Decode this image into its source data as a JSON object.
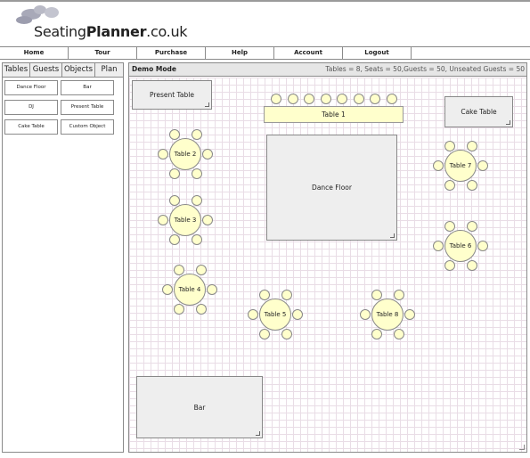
{
  "logo": {
    "prefix": "Seating",
    "bold": "Planner",
    "suffix": ".co.uk"
  },
  "nav": [
    "Home",
    "Tour",
    "Purchase",
    "Help",
    "Account",
    "Logout"
  ],
  "tabs": [
    "Tables",
    "Guests",
    "Objects",
    "Plan"
  ],
  "objects": [
    "Dance Floor",
    "Bar",
    "DJ",
    "Present Table",
    "Cake Table",
    "Custom Object"
  ],
  "header": {
    "mode": "Demo Mode",
    "stats": "Tables = 8, Seats = 50,Guests = 50, Unseated Guests = 50"
  },
  "plan": {
    "present_table": "Present Table",
    "cake_table": "Cake Table",
    "dance_floor": "Dance Floor",
    "bar": "Bar",
    "table1": "Table 1",
    "tables": [
      "Table 2",
      "Table 3",
      "Table 4",
      "Table 5",
      "Table 6",
      "Table 7",
      "Table 8"
    ]
  },
  "colors": {
    "table_fill": "#ffffcc",
    "grid": "#e9dde6",
    "header_bg": "#e6e6e6"
  }
}
